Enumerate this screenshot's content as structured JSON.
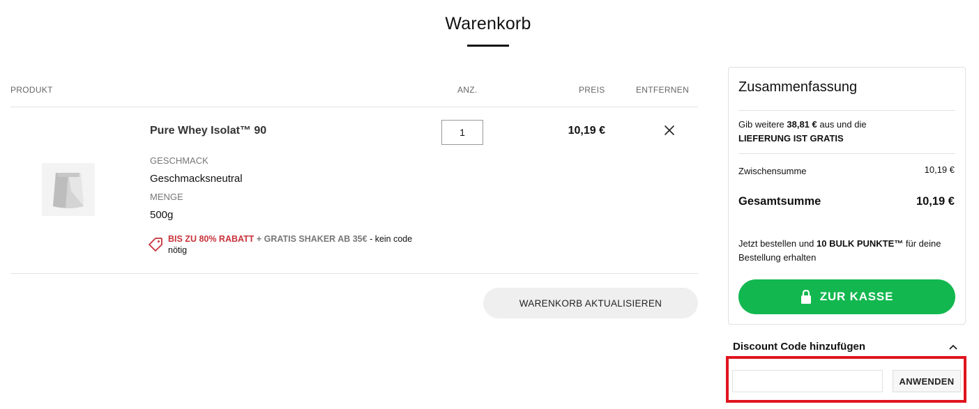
{
  "page": {
    "title": "Warenkorb"
  },
  "columns": {
    "product": "PRODUKT",
    "qty": "ANZ.",
    "price": "PREIS",
    "remove": "ENTFERNEN"
  },
  "item": {
    "name": "Pure Whey Isolat™ 90",
    "flavor_label": "GESCHMACK",
    "flavor_value": "Geschmacksneutral",
    "amount_label": "MENGE",
    "amount_value": "500g",
    "quantity": "1",
    "price": "10,19 €",
    "promo_red": "BIS ZU 80% RABATT",
    "promo_grey": " + GRATIS SHAKER AB 35€",
    "promo_rest": " - kein code nötig"
  },
  "update_button": "WARENKORB AKTUALISIEREN",
  "summary": {
    "title": "Zusammenfassung",
    "free_shipping_prefix": "Gib weitere ",
    "free_shipping_amount": "38,81 €",
    "free_shipping_suffix": " aus und die",
    "free_shipping_line2": "LIEFERUNG IST GRATIS",
    "subtotal_label": "Zwischensumme",
    "subtotal_value": "10,19 €",
    "total_label": "Gesamtsumme",
    "total_value": "10,19 €",
    "points_prefix": "Jetzt bestellen und ",
    "points_bold": "10 BULK PUNKTE™",
    "points_suffix": " für deine",
    "points_line2": "Bestellung erhalten",
    "checkout_button": "ZUR KASSE"
  },
  "discount": {
    "title": "Discount Code hinzufügen",
    "input_value": "",
    "apply_button": "ANWENDEN"
  },
  "colors": {
    "checkout_green": "#12b84f",
    "promo_red": "#c8323a",
    "highlight_red": "#e0141e"
  },
  "icons": {
    "remove": "close-icon",
    "promo": "tag-icon",
    "checkout": "lock-icon",
    "discount_toggle": "chevron-up-icon"
  }
}
